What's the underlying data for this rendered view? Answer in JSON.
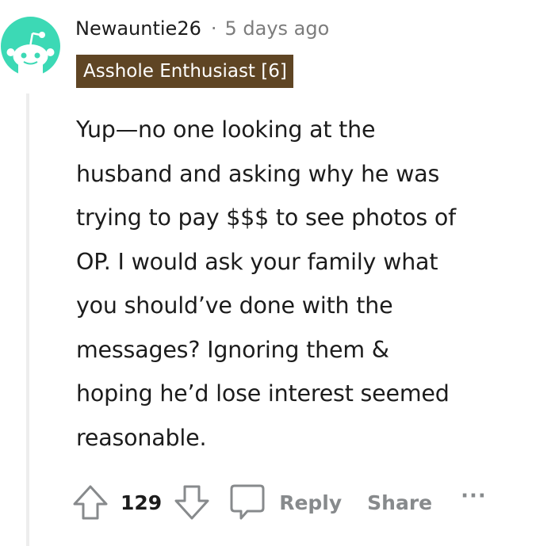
{
  "comment": {
    "author": "Newauntie26",
    "separator": "·",
    "timestamp": "5 days ago",
    "flair": "Asshole Enthusiast [6]",
    "body_lines": [
      "Yup—no one looking at the",
      "husband and asking why he was",
      "trying to pay $$$ to see photos of",
      "OP. I would ask your family what",
      "you should’ve done with the",
      "messages? Ignoring them &",
      "hoping he’d lose interest seemed",
      "reasonable."
    ],
    "vote_count": "129",
    "reply_label": "Reply",
    "share_label": "Share",
    "more_label": "···"
  },
  "icons": {
    "avatar": "snoo-avatar-icon",
    "upvote": "upvote-arrow-icon",
    "downvote": "downvote-arrow-icon",
    "reply": "comment-bubble-icon",
    "more": "ellipsis-icon"
  },
  "colors": {
    "avatar_bg": "#3cd9b5",
    "flair_bg": "#5f4524",
    "muted_text": "#7c7c7c",
    "action_text": "#878a8c"
  }
}
